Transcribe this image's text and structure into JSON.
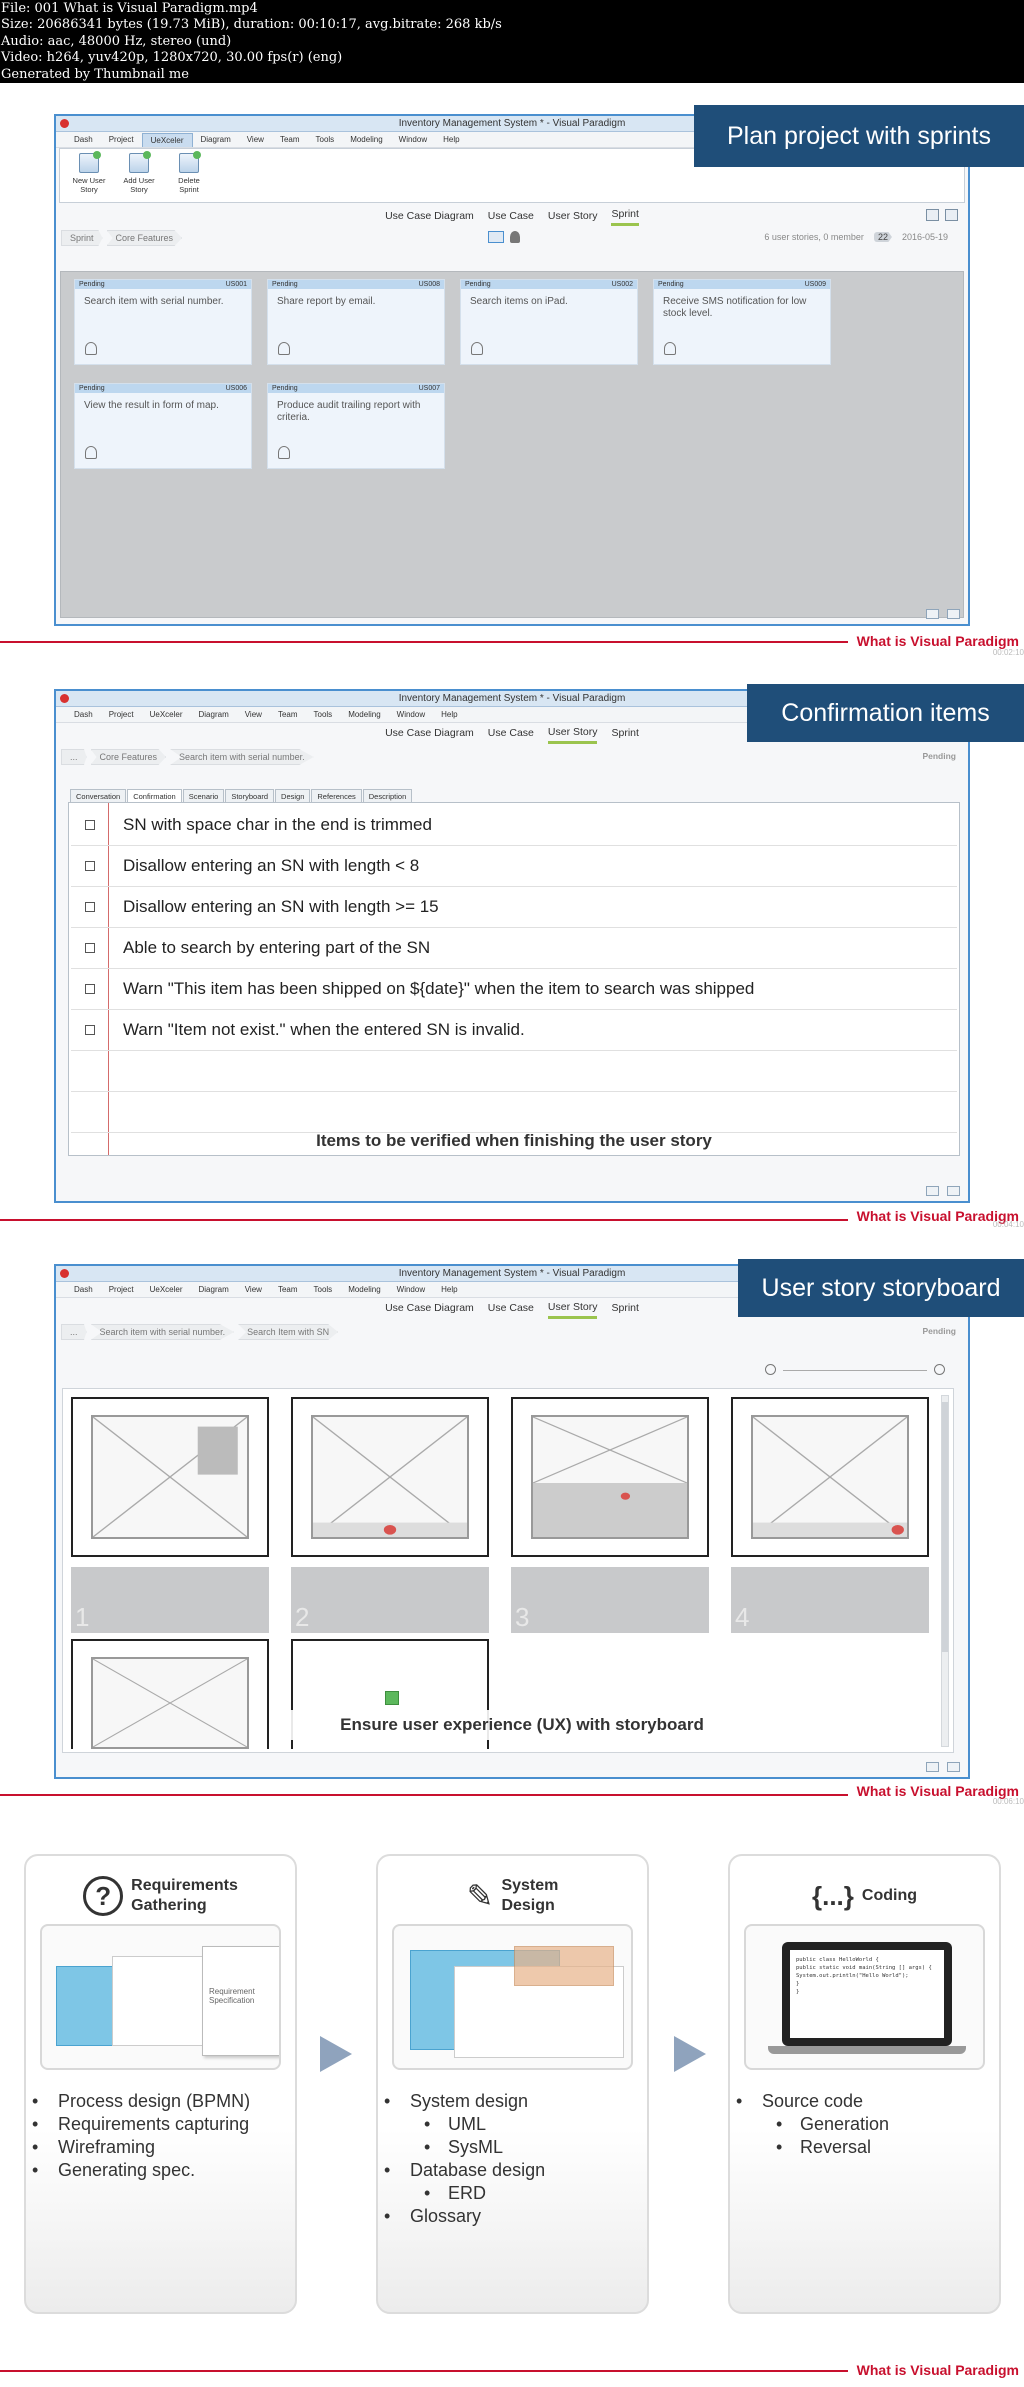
{
  "file_info": {
    "lines": [
      "File: 001 What is Visual Paradigm.mp4",
      "Size: 20686341 bytes (19.73 MiB), duration: 00:10:17, avg.bitrate: 268 kb/s",
      "Audio: aac, 48000 Hz, stereo (und)",
      "Video: h264, yuv420p, 1280x720, 30.00 fps(r) (eng)",
      "Generated by Thumbnail me"
    ]
  },
  "app_title": "Inventory Management System * - Visual Paradigm",
  "menu": [
    "Dash",
    "Project",
    "UeXceler",
    "Diagram",
    "View",
    "Team",
    "Tools",
    "Modeling",
    "Window",
    "Help"
  ],
  "brand": "What is Visual Paradigm",
  "timestamps": [
    "00:02:10",
    "00:04:10",
    "00:06:10"
  ],
  "frame1": {
    "callout": "Plan project with sprints",
    "ribbon": [
      {
        "label": "New User Story"
      },
      {
        "label": "Add User Story"
      },
      {
        "label": "Delete Sprint"
      }
    ],
    "tabs": [
      "Use Case Diagram",
      "Use Case",
      "User Story",
      "Sprint"
    ],
    "active_tab": "Sprint",
    "breadcrumb": [
      "Sprint",
      "Core Features"
    ],
    "meta_text": "6 user stories, 0 member",
    "meta_count": "22",
    "meta_date": "2016-05-19",
    "cards": [
      {
        "status": "Pending",
        "id": "US001",
        "text": "Search item with serial number."
      },
      {
        "status": "Pending",
        "id": "US008",
        "text": "Share report by email."
      },
      {
        "status": "Pending",
        "id": "US002",
        "text": "Search items on iPad."
      },
      {
        "status": "Pending",
        "id": "US009",
        "text": "Receive SMS notification for low stock level."
      },
      {
        "status": "Pending",
        "id": "US006",
        "text": "View the result in form of map."
      },
      {
        "status": "Pending",
        "id": "US007",
        "text": "Produce audit trailing report with criteria."
      }
    ]
  },
  "frame2": {
    "callout": "Confirmation items",
    "tabs": [
      "Use Case Diagram",
      "Use Case",
      "User Story",
      "Sprint"
    ],
    "active_tab": "User Story",
    "breadcrumb": [
      "...",
      "Core Features",
      "Search item with serial number."
    ],
    "status": "Pending",
    "subtabs": [
      "Conversation",
      "Confirmation",
      "Scenario",
      "Storyboard",
      "Design",
      "References",
      "Description"
    ],
    "active_subtab": "Confirmation",
    "items": [
      "SN with space char in the end is trimmed",
      "Disallow entering an SN with length < 8",
      "Disallow entering an SN with length >= 15",
      "Able to search by entering part of the SN",
      "Warn \"This item has been shipped on ${date}\" when the item to search was shipped",
      "Warn \"Item not exist.\" when the entered SN is invalid."
    ],
    "footer": "Items to be verified when finishing the user story"
  },
  "frame3": {
    "callout": "User story storyboard",
    "tabs": [
      "Use Case Diagram",
      "Use Case",
      "User Story",
      "Sprint"
    ],
    "active_tab": "User Story",
    "breadcrumb": [
      "...",
      "Search item with serial number.",
      "Search Item with SN"
    ],
    "status": "Pending",
    "screens": [
      "1",
      "2",
      "3",
      "4"
    ],
    "caption": "Ensure user experience (UX) with storyboard"
  },
  "overview": {
    "columns": [
      {
        "title": [
          "Requirements",
          "Gathering"
        ],
        "icon": "question-icon",
        "thumb_label": [
          "Requirement",
          "Specification"
        ],
        "bullets": [
          {
            "text": "Process design (BPMN)",
            "level": 1
          },
          {
            "text": "Requirements capturing",
            "level": 1
          },
          {
            "text": "Wireframing",
            "level": 1
          },
          {
            "text": "Generating spec.",
            "level": 1
          }
        ]
      },
      {
        "title": [
          "System",
          "Design"
        ],
        "icon": "pen-icon",
        "bullets": [
          {
            "text": "System design",
            "level": 1
          },
          {
            "text": "UML",
            "level": 2
          },
          {
            "text": "SysML",
            "level": 2
          },
          {
            "text": "Database design",
            "level": 1
          },
          {
            "text": "ERD",
            "level": 2
          },
          {
            "text": "Glossary",
            "level": 1
          }
        ]
      },
      {
        "title": [
          "Coding"
        ],
        "icon": "code-braces-icon",
        "icon_text": "{...}",
        "code_lines": [
          "public class HelloWorld {",
          "  public static void main(String [] args) {",
          "    System.out.println(\"Hello World\");",
          "  }",
          "}"
        ],
        "bullets": [
          {
            "text": "Source code",
            "level": 1
          },
          {
            "text": "Generation",
            "level": 2
          },
          {
            "text": "Reversal",
            "level": 2
          }
        ]
      }
    ]
  },
  "colors": {
    "accent": "#1f4e79",
    "brand": "#c8102e",
    "frame_border": "#4a8fcf",
    "active_tab": "#9bc44e"
  }
}
